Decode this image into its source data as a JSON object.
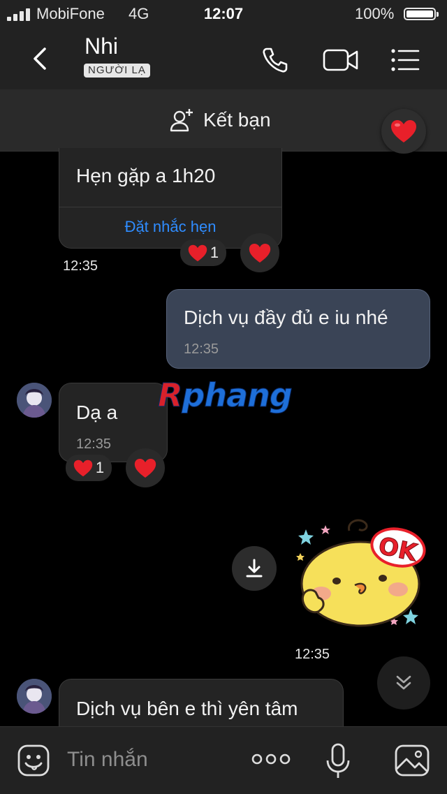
{
  "status_bar": {
    "carrier": "MobiFone",
    "network": "4G",
    "time": "12:07",
    "battery": "100%",
    "battery_level": 1.0
  },
  "header": {
    "contact_name": "Nhi",
    "badge": "NGƯỜI LẠ",
    "icons": [
      "back-icon",
      "phone-icon",
      "video-icon",
      "menu-icon"
    ]
  },
  "friend_bar": {
    "label": "Kết bạn",
    "icon": "add-friend-icon"
  },
  "messages": [
    {
      "id": "m1",
      "side": "received",
      "text": "Hẹn gặp a 1h20",
      "action": "Đặt nhắc hẹn",
      "timestamp": "12:35",
      "reaction_count": "1"
    },
    {
      "id": "m2",
      "side": "sent",
      "text": "Dịch vụ đầy đủ e iu nhé",
      "time": "12:35"
    },
    {
      "id": "m3",
      "side": "received",
      "text": "Dạ a",
      "time": "12:35",
      "reaction_count": "1"
    },
    {
      "id": "m4",
      "side": "sent",
      "type": "sticker",
      "sticker_text": "OK",
      "timestamp": "12:35"
    },
    {
      "id": "m5",
      "side": "received",
      "text": "Dịch vụ bên e thì yên tâm"
    }
  ],
  "watermark": "Rphang",
  "input_bar": {
    "placeholder": "Tin nhắn",
    "icons": [
      "emoji-icon",
      "more-icon",
      "microphone-icon",
      "image-icon"
    ]
  },
  "colors": {
    "background": "#000000",
    "bar": "#222222",
    "received_bubble": "#242424",
    "sent_bubble": "#3a4456",
    "link": "#2f8cff",
    "heart": "#e8202a"
  }
}
